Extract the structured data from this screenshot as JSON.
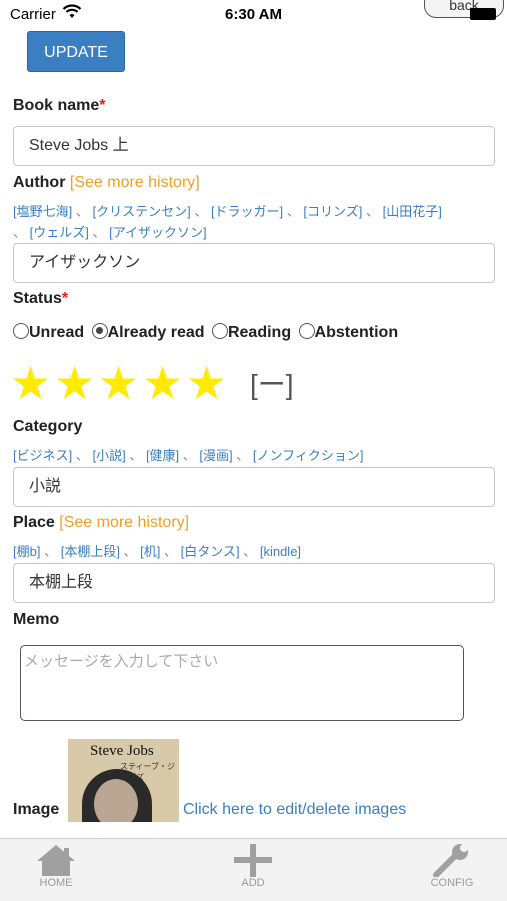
{
  "status_bar": {
    "carrier": "Carrier",
    "time": "6:30 AM",
    "back_label": "back"
  },
  "update_button": "UPDATE",
  "book_name": {
    "label": "Book name",
    "required": "*",
    "value": "Steve Jobs 上"
  },
  "author": {
    "label": "Author",
    "history_link": "[See more history]",
    "suggestions": [
      "[塩野七海]",
      "[クリステンセン]",
      "[ドラッガー]",
      "[コリンズ]",
      "[山田花子]",
      "[ウェルズ]",
      "[アイザックソン]"
    ],
    "value": "アイザックソン"
  },
  "status": {
    "label": "Status",
    "required": "*",
    "options": [
      "Unread",
      "Already read",
      "Reading",
      "Abstention"
    ],
    "selected": "Already read"
  },
  "rating": {
    "value": 5,
    "max": 5,
    "clear_label": "[ー]"
  },
  "category": {
    "label": "Category",
    "suggestions": [
      "[ビジネス]",
      "[小説]",
      "[健康]",
      "[漫画]",
      "[ノンフィクション]"
    ],
    "value": "小説"
  },
  "place": {
    "label": "Place",
    "history_link": "[See more history]",
    "suggestions": [
      "[棚b]",
      "[本棚上段]",
      "[机]",
      "[白タンス]",
      "[kindle]"
    ],
    "value": "本棚上段"
  },
  "memo": {
    "label": "Memo",
    "placeholder": "メッセージを入力して下さい"
  },
  "image": {
    "label": "Image",
    "cover_title": "Steve Jobs",
    "cover_subtitle": "スティーブ・ジョブズ",
    "edit_link": "Click here to edit/delete images"
  },
  "tabbar": {
    "home": "HOME",
    "add": "ADD",
    "config": "CONFIG"
  },
  "colors": {
    "accent": "#3a7fc1",
    "star": "#ffea00",
    "required": "#e02020",
    "history": "#f0a020"
  }
}
